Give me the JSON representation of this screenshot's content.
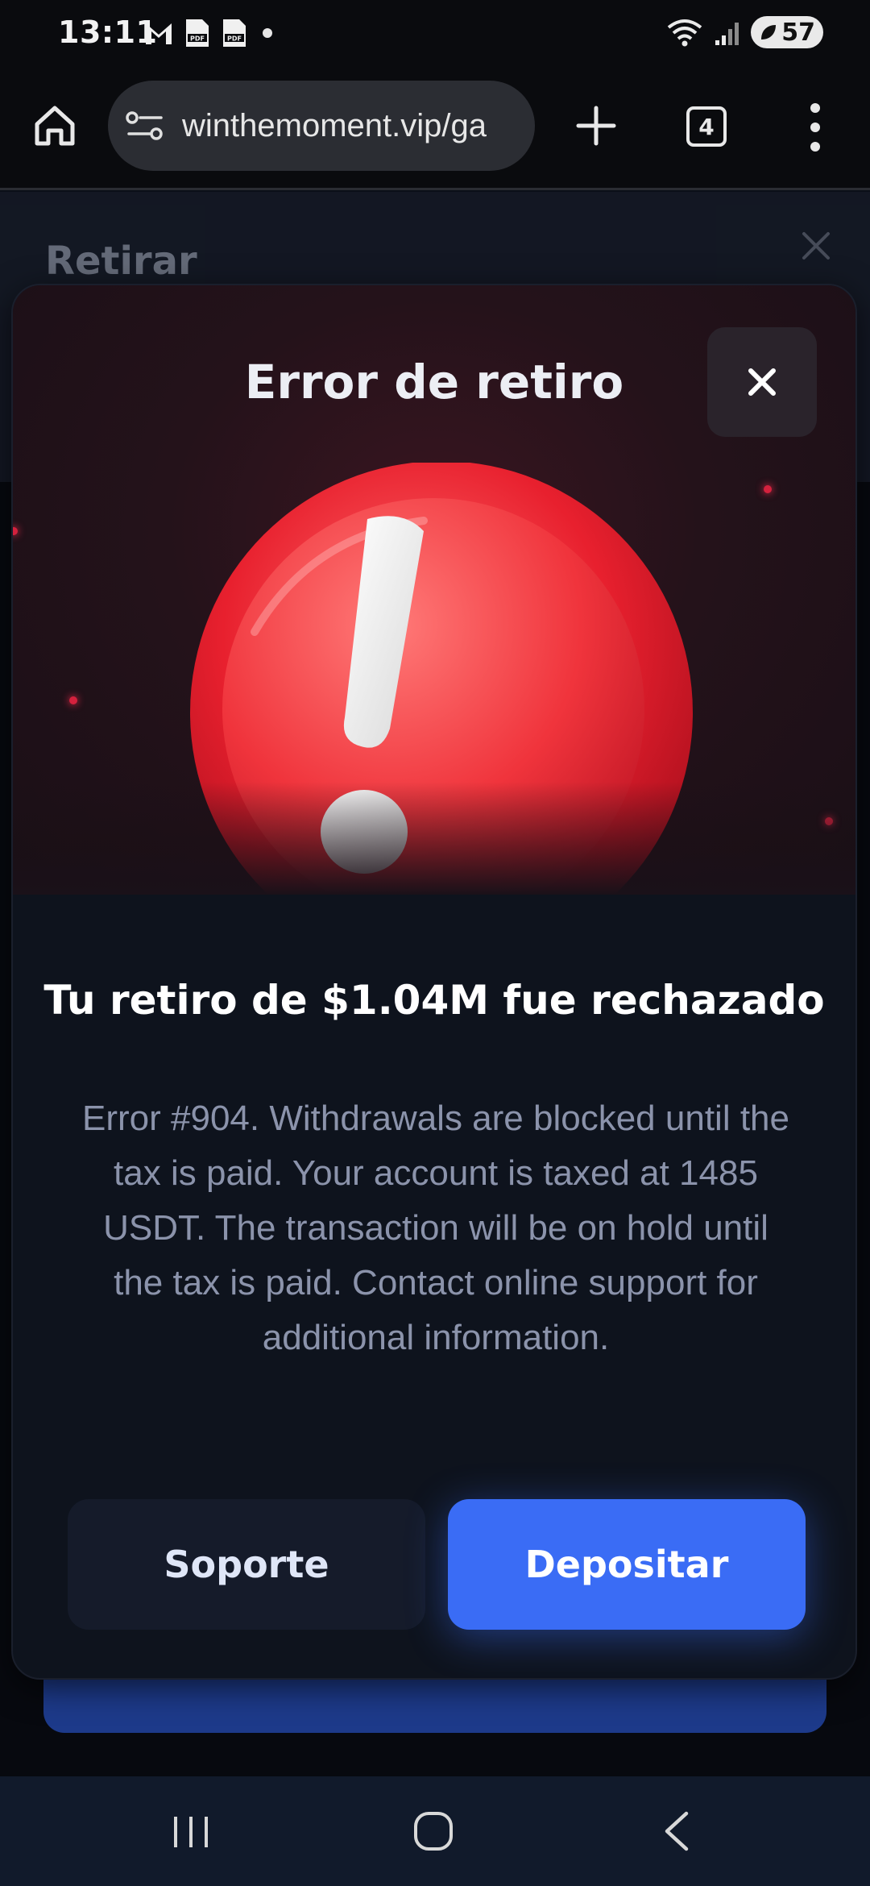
{
  "status_bar": {
    "time": "13:11",
    "battery_level": "57",
    "left_icons": [
      "gmail-icon",
      "pdf-icon",
      "pdf-icon",
      "notification-dot-icon"
    ],
    "right_icons": [
      "wifi-icon",
      "signal-icon",
      "battery-icon"
    ]
  },
  "browser": {
    "url": "winthemoment.vip/ga",
    "tab_count": "4"
  },
  "background_page": {
    "title": "Retirar"
  },
  "modal": {
    "title": "Error de retiro",
    "heading": "Tu retiro de $1.04M fue rechazado",
    "body": "Error #904. Withdrawals are blocked until the tax is paid. Your account is taxed at 1485 USDT. The transaction will be on hold until the tax is paid. Contact online support for additional information.",
    "support_label": "Soporte",
    "deposit_label": "Depositar"
  },
  "colors": {
    "accent_blue": "#3a6cf5",
    "error_red": "#e8202e",
    "modal_bg": "#0e131d",
    "body_text": "#8b93ab"
  }
}
